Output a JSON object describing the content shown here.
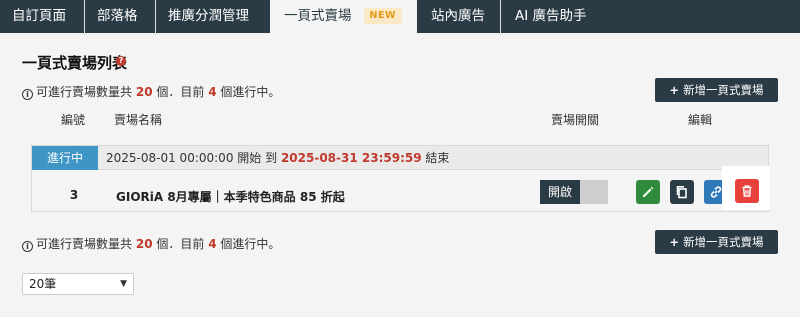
{
  "nav": {
    "items": [
      {
        "label": "自訂頁面"
      },
      {
        "label": "部落格"
      },
      {
        "label": "推廣分潤管理"
      },
      {
        "label": "一頁式賣場",
        "badge": "NEW",
        "active": true
      },
      {
        "label": "站內廣告"
      },
      {
        "label": "AI 廣告助手"
      }
    ]
  },
  "page": {
    "title": "一頁式賣場列表",
    "help_icon": "question-circle-icon"
  },
  "summary": {
    "prefix": "可進行賣場數量共",
    "total": "20",
    "middle": "個．目前",
    "current": "4",
    "suffix": "個進行中。",
    "icon": "info-circle-icon"
  },
  "add_button": {
    "label": "新增一頁式賣場",
    "icon": "plus-icon"
  },
  "table": {
    "headers": {
      "id": "編號",
      "name": "賣場名稱",
      "toggle": "賣場開關",
      "edit": "編輯"
    },
    "rows": [
      {
        "status": "進行中",
        "start": "2025-08-01 00:00:00",
        "start_label": "開始 到",
        "end": "2025-08-31 23:59:59",
        "end_label": "結束",
        "id": "3",
        "name": "GIORiA 8月專屬｜本季特色商品 85 折起",
        "toggle_label": "開啟",
        "toggle_on": true,
        "actions": [
          "pencil-icon",
          "copy-icon",
          "link-icon",
          "trash-icon"
        ]
      }
    ]
  },
  "pagination": {
    "per_page": "20筆"
  },
  "colors": {
    "nav_bg": "#2b3b45",
    "status": "#3f95c6",
    "red": "#c0392b",
    "edit": "#2e8b3c",
    "link": "#2f79b8",
    "delete": "#e8403a"
  }
}
